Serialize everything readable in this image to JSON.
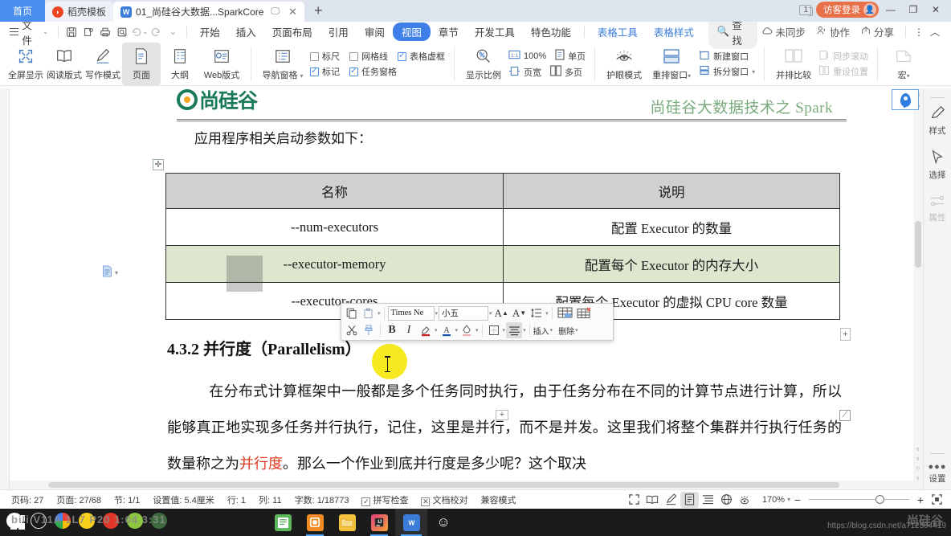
{
  "window": {
    "tabs": [
      {
        "label": "首页",
        "type": "home"
      },
      {
        "label": "稻壳模板",
        "type": "inactive",
        "icon": "daoke-icon"
      },
      {
        "label": "01_尚硅谷大数据...SparkCore",
        "type": "active",
        "icon": "word-icon"
      }
    ],
    "new_tab_label": "+",
    "window_count": "1",
    "guest_login": "访客登录",
    "minimize": "—",
    "maximize": "❐",
    "close": "✕"
  },
  "menubar": {
    "file": "文件",
    "quick_tools": [
      "save-icon",
      "save-as-icon",
      "print-icon",
      "print-preview-icon",
      "undo-icon",
      "redo-icon",
      "customize-icon"
    ],
    "items": [
      {
        "label": "开始",
        "state": "normal"
      },
      {
        "label": "插入",
        "state": "normal"
      },
      {
        "label": "页面布局",
        "state": "normal"
      },
      {
        "label": "引用",
        "state": "normal"
      },
      {
        "label": "审阅",
        "state": "normal"
      },
      {
        "label": "视图",
        "state": "active"
      },
      {
        "label": "章节",
        "state": "normal"
      },
      {
        "label": "开发工具",
        "state": "normal"
      },
      {
        "label": "特色功能",
        "state": "normal"
      },
      {
        "label": "表格工具",
        "state": "blue"
      },
      {
        "label": "表格样式",
        "state": "blue"
      }
    ],
    "find": "查找",
    "sync": "未同步",
    "collab": "协作",
    "share": "分享",
    "more": "⋮",
    "collapse": "︿"
  },
  "ribbon": {
    "group1": [
      {
        "label": "全屏显示",
        "icon": "fullscreen-icon",
        "selected": false
      },
      {
        "label": "阅读版式",
        "icon": "book-icon",
        "selected": false
      },
      {
        "label": "写作模式",
        "icon": "pencil-icon",
        "selected": false
      },
      {
        "label": "页面",
        "icon": "page-icon",
        "selected": true
      },
      {
        "label": "大纲",
        "icon": "outline-icon",
        "selected": false
      },
      {
        "label": "Web版式",
        "icon": "web-icon",
        "selected": false
      }
    ],
    "nav_pane": "导航窗格",
    "checks": [
      {
        "label": "标尺",
        "checked": false
      },
      {
        "label": "网格线",
        "checked": false
      },
      {
        "label": "表格虚框",
        "checked": true
      },
      {
        "label": "标记",
        "checked": true
      },
      {
        "label": "任务窗格",
        "checked": true
      }
    ],
    "zoom_group": [
      {
        "label": "显示比例",
        "icon": "zoom-icon"
      },
      {
        "label": "100%",
        "icon": "onehundred-icon"
      },
      {
        "label": "页宽",
        "icon": "pagewidth-icon"
      },
      {
        "label": "单页",
        "icon": "singlepage-icon"
      },
      {
        "label": "多页",
        "icon": "multipage-icon"
      }
    ],
    "eye_mode": "护眼模式",
    "rearrange": "重排窗口",
    "new_window": "新建窗口",
    "split_window": "拆分窗口",
    "side_by_side": "并排比较",
    "sync_scroll": "同步滚动",
    "reset_position": "重设位置",
    "macro": "宏"
  },
  "document": {
    "header_logo": "尚硅谷",
    "header_right": "尚硅谷大数据技术之 Spark",
    "intro": "应用程序相关启动参数如下：",
    "table": {
      "headers": [
        "名称",
        "说明"
      ],
      "rows": [
        {
          "name": "--num-executors",
          "desc": "配置 Executor 的数量",
          "selected": false
        },
        {
          "name": "--executor-memory",
          "desc": "配置每个 Executor 的内存大小",
          "selected": true
        },
        {
          "name": "--executor-cores",
          "desc": "配置每个 Executor 的虚拟 CPU core 数量",
          "selected": false
        }
      ]
    },
    "heading": "4.3.2  并行度（Parallelism）",
    "body_line1": "在分布式计算框架中一般都是多个任务同时执行，由于任务分布在不同的计算节点进行",
    "body_line2": "计算，所以能够真正地实现多任务并行执行，记住，这里是并行，而不是并发。这里我们将",
    "body_line3_a": "整个集群并行执行任务的数量称之为",
    "body_line3_highlight": "并行度",
    "body_line3_b": "。那么一个作业到底并行度是多少呢？这个取决"
  },
  "mini_toolbar": {
    "copy": "copy-icon",
    "paste": "paste-icon",
    "font_name": "Times Ne",
    "font_size": "小五",
    "grow_font": "A⁺",
    "shrink_font": "A⁻",
    "line_spacing": "line-spacing-icon",
    "insert": "插入",
    "delete": "删除",
    "cut": "cut-icon",
    "format_painter": "format-painter-icon",
    "bold": "B",
    "italic": "I",
    "highlight": "highlight-icon",
    "font_color": "font-color-icon",
    "shading": "shading-icon",
    "borders": "borders-icon",
    "align": "align-icon"
  },
  "right_sidebar": {
    "items": [
      {
        "label": "样式",
        "icon": "style-pen-icon",
        "disabled": false
      },
      {
        "label": "选择",
        "icon": "cursor-select-icon",
        "disabled": false
      },
      {
        "label": "属性",
        "icon": "properties-icon",
        "disabled": true
      }
    ],
    "settings": "设置",
    "map_pin": "location-pin-icon"
  },
  "status_bar": {
    "page_number": "页码: 27",
    "page_of": "页面: 27/68",
    "section": "节: 1/1",
    "setting_value": "设置值: 5.4厘米",
    "row": "行: 1",
    "col": "列: 11",
    "word_count": "字数: 1/18773",
    "spell_check": "拼写检查",
    "doc_proof": "文档校对",
    "compat_mode": "兼容模式",
    "view_buttons": [
      {
        "icon": "fullscreen-small-icon",
        "selected": false
      },
      {
        "icon": "read-layout-icon",
        "selected": false
      },
      {
        "icon": "write-mode-icon",
        "selected": false
      },
      {
        "icon": "page-view-icon",
        "selected": true
      },
      {
        "icon": "outline-view-icon",
        "selected": false
      },
      {
        "icon": "web-view-icon",
        "selected": false
      },
      {
        "icon": "eye-protect-icon",
        "selected": false
      }
    ],
    "zoom_level": "170%",
    "zoom_out": "−",
    "zoom_in": "+",
    "fit_page": "fit-page-icon"
  },
  "taskbar": {
    "start": "start-icon",
    "ghost_text": "bili  V11A  1L7  P20  1:04  3:31",
    "items": [
      {
        "name": "wps-writer-icon",
        "color": "#5db85c"
      },
      {
        "name": "vmware-icon",
        "color": "#f28b22"
      },
      {
        "name": "file-explorer-icon",
        "color": "#f5c33b"
      },
      {
        "name": "jetbrains-icon",
        "color": "#e0407d"
      },
      {
        "name": "wps-active-icon",
        "color": "#3a7cd8"
      },
      {
        "name": "emoji-icon",
        "color": "#ffffff"
      }
    ],
    "watermark": "https://blog.csdn.net/a712304419",
    "watermark2": "尚硅谷"
  }
}
